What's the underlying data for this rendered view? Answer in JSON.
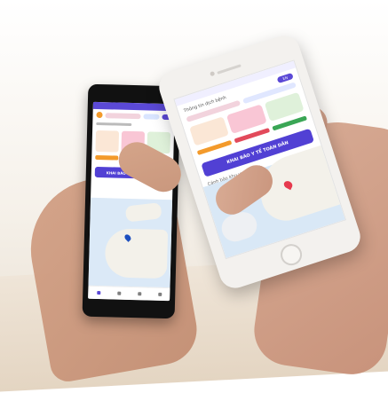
{
  "left_phone": {
    "cta_label": "KHAI BÁO Y TẾ TOÀN DÂN"
  },
  "right_phone": {
    "header_label": "Thông tin dịch bệnh",
    "language_badge": "EN",
    "cta_label": "KHAI BÁO Y TẾ TOÀN DÂN",
    "map_caption": "Cảnh báo khu vực có dịch"
  },
  "colors": {
    "accent": "#5140D4",
    "status_orange": "#F39A2B",
    "status_red": "#E24A5B",
    "status_green": "#3AA655",
    "map_water": "#D9E8F6",
    "map_pin_left": "#1D4FBF",
    "map_pin_right": "#E63A4E"
  }
}
